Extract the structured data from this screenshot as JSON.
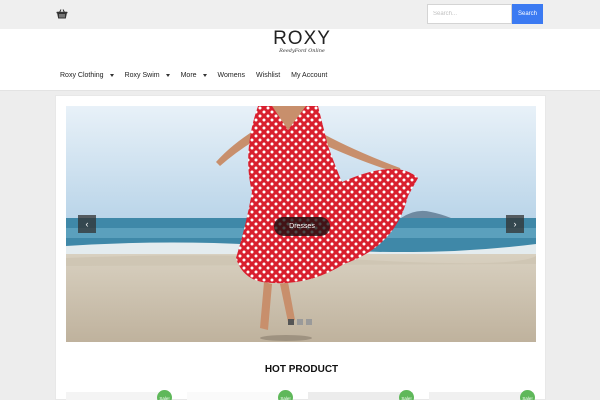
{
  "topbar": {
    "cart_icon": "basket-icon",
    "search_placeholder": "Search...",
    "search_button": "Search"
  },
  "header": {
    "logo_main": "ROXY",
    "logo_sub": "ReedyFord Online"
  },
  "nav": {
    "items": [
      {
        "label": "Roxy Clothing",
        "dropdown": true
      },
      {
        "label": "Roxy Swim",
        "dropdown": true
      },
      {
        "label": "More",
        "dropdown": true
      },
      {
        "label": "Womens",
        "dropdown": false
      },
      {
        "label": "Wishlist",
        "dropdown": false
      },
      {
        "label": "My Account",
        "dropdown": false
      }
    ]
  },
  "slider": {
    "caption": "Dresses",
    "prev_icon": "chevron-left-icon",
    "next_icon": "chevron-right-icon",
    "slide_count": 3,
    "active_slide": 1
  },
  "hot_product": {
    "title": "HOT PRODUCT",
    "badges": [
      "Sale!",
      "Sale!",
      "Sale!",
      "Sale!"
    ]
  },
  "colors": {
    "accent": "#3b7af2",
    "sale_badge": "#5fb85a",
    "dress_red": "#d91f2e"
  }
}
